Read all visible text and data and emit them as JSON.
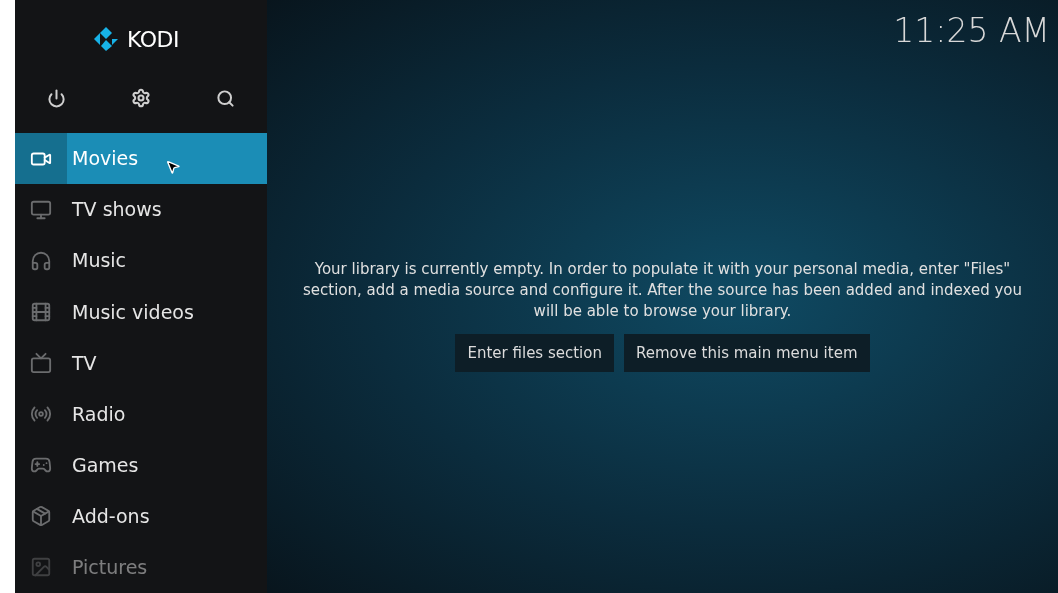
{
  "logo": {
    "text": "KODI"
  },
  "clock": "11:25 AM",
  "menu": [
    {
      "label": "Movies",
      "selected": true
    },
    {
      "label": "TV shows",
      "selected": false
    },
    {
      "label": "Music",
      "selected": false
    },
    {
      "label": "Music videos",
      "selected": false
    },
    {
      "label": "TV",
      "selected": false
    },
    {
      "label": "Radio",
      "selected": false
    },
    {
      "label": "Games",
      "selected": false
    },
    {
      "label": "Add-ons",
      "selected": false
    },
    {
      "label": "Pictures",
      "selected": false
    }
  ],
  "message": "Your library is currently empty. In order to populate it with your personal media, enter \"Files\" section, add a media source and configure it. After the source has been added and indexed you will be able to browse your library.",
  "buttons": [
    "Enter files section",
    "Remove this main menu item"
  ]
}
